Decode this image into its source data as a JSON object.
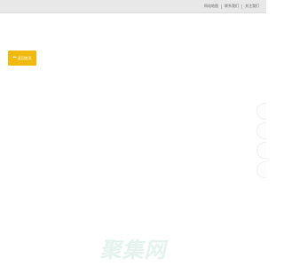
{
  "header": {
    "links": [
      "网站地图",
      "联系我们",
      "关注我们"
    ]
  },
  "back_button": {
    "icon": "arrow-left-icon",
    "label": "返回首页"
  },
  "side_tools": [
    "tool-1",
    "tool-2",
    "tool-3",
    "tool-4"
  ],
  "brand": {
    "watermark": "聚集网"
  },
  "colors": {
    "topbar": "#e8e8e8",
    "accent": "#f0b90b",
    "watermark": "#e4f3ee"
  }
}
